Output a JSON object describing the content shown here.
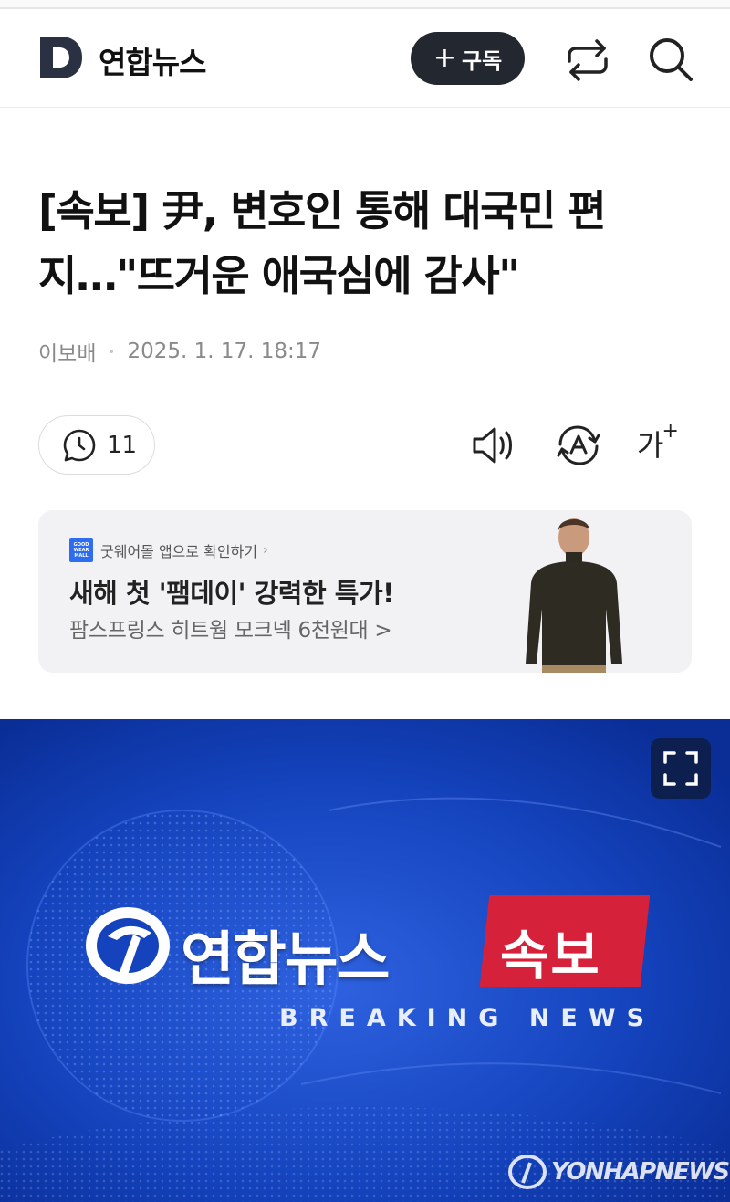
{
  "header": {
    "brand": "연합뉴스",
    "subscribe_label": "구독",
    "subscribe_plus": "+"
  },
  "article": {
    "headline": "[속보] 尹, 변호인 통해 대국민 편지…\"뜨거운 애국심에 감사\"",
    "author": "이보배",
    "published": "2025. 1. 17. 18:17",
    "comment_count": "11",
    "font_size_label": "가",
    "font_size_plus": "+"
  },
  "ad": {
    "source": "굿웨어몰 앱으로 확인하기",
    "source_chevron": "›",
    "logo_text": "GOOD WEAR MALL",
    "title": "새해 첫 '팸데이' 강력한 특가!",
    "subtitle": "팜스프링스 히트웜 모크넥 6천원대 >"
  },
  "hero": {
    "brand": "연합뉴스",
    "badge": "속보",
    "breaking": "BREAKING NEWS",
    "watermark": "YONHAPNEWS"
  },
  "colors": {
    "subscribe_bg": "#23272f",
    "hero_bg": "#0d35a8",
    "badge_red": "#d6213a",
    "ad_bg": "#f2f2f4"
  },
  "icons": [
    "daum-logo-icon",
    "share-icon",
    "search-icon",
    "comment-clock-icon",
    "speaker-icon",
    "translate-icon",
    "expand-icon",
    "yonhap-logo-icon"
  ]
}
